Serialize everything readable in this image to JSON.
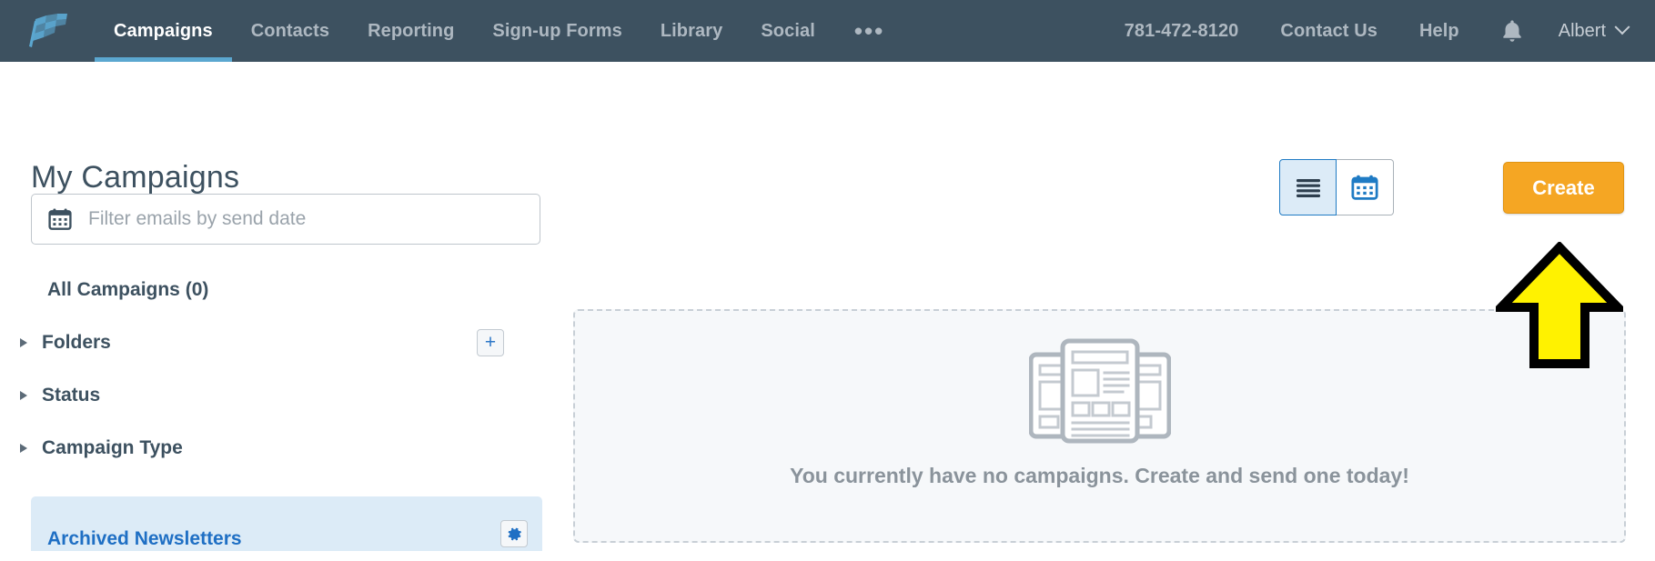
{
  "topnav": {
    "logo_icon": "checkered-flag-logo",
    "left_items": [
      {
        "label": "Campaigns",
        "active": true
      },
      {
        "label": "Contacts",
        "active": false
      },
      {
        "label": "Reporting",
        "active": false
      },
      {
        "label": "Sign-up Forms",
        "active": false
      },
      {
        "label": "Library",
        "active": false
      },
      {
        "label": "Social",
        "active": false
      }
    ],
    "overflow_label": "•••",
    "phone": "781-472-8120",
    "contact_us": "Contact Us",
    "help": "Help",
    "bell_icon": "notification-bell-icon",
    "user_name": "Albert",
    "caret_icon": "chevron-down-icon",
    "bg_color": "#3D5160",
    "active_underline_color": "#5BA7D0"
  },
  "page": {
    "title": "My Campaigns"
  },
  "date_filter": {
    "icon": "calendar-icon",
    "placeholder": "Filter emails by send date",
    "value": ""
  },
  "sidebar": {
    "all_campaigns": "All Campaigns (0)",
    "groups": [
      {
        "label": "Folders",
        "action_icon": "plus-icon",
        "action_label": "+"
      },
      {
        "label": "Status",
        "action_icon": null,
        "action_label": ""
      },
      {
        "label": "Campaign Type",
        "action_icon": null,
        "action_label": ""
      }
    ],
    "archived": {
      "label": "Archived Newsletters",
      "gear_icon": "gear-icon",
      "highlight_color": "#DCEBF7",
      "text_color": "#1F6FC4"
    }
  },
  "toolbar": {
    "view_toggle": [
      {
        "icon": "list-view-icon",
        "label": "List view",
        "selected": true
      },
      {
        "icon": "calendar-view-icon",
        "label": "Calendar view",
        "selected": false
      }
    ],
    "create_label": "Create",
    "create_color": "#F5A623"
  },
  "empty_state": {
    "illustration": "newsletters-illustration",
    "message": "You currently have no campaigns. Create and send one today!",
    "bg_color": "#F6F8FA",
    "border_color": "#C8CFD6"
  },
  "annotation": {
    "arrow_icon": "up-arrow-annotation",
    "fill_color": "#FFF200",
    "stroke_color": "#000000",
    "points_to": "Create"
  }
}
